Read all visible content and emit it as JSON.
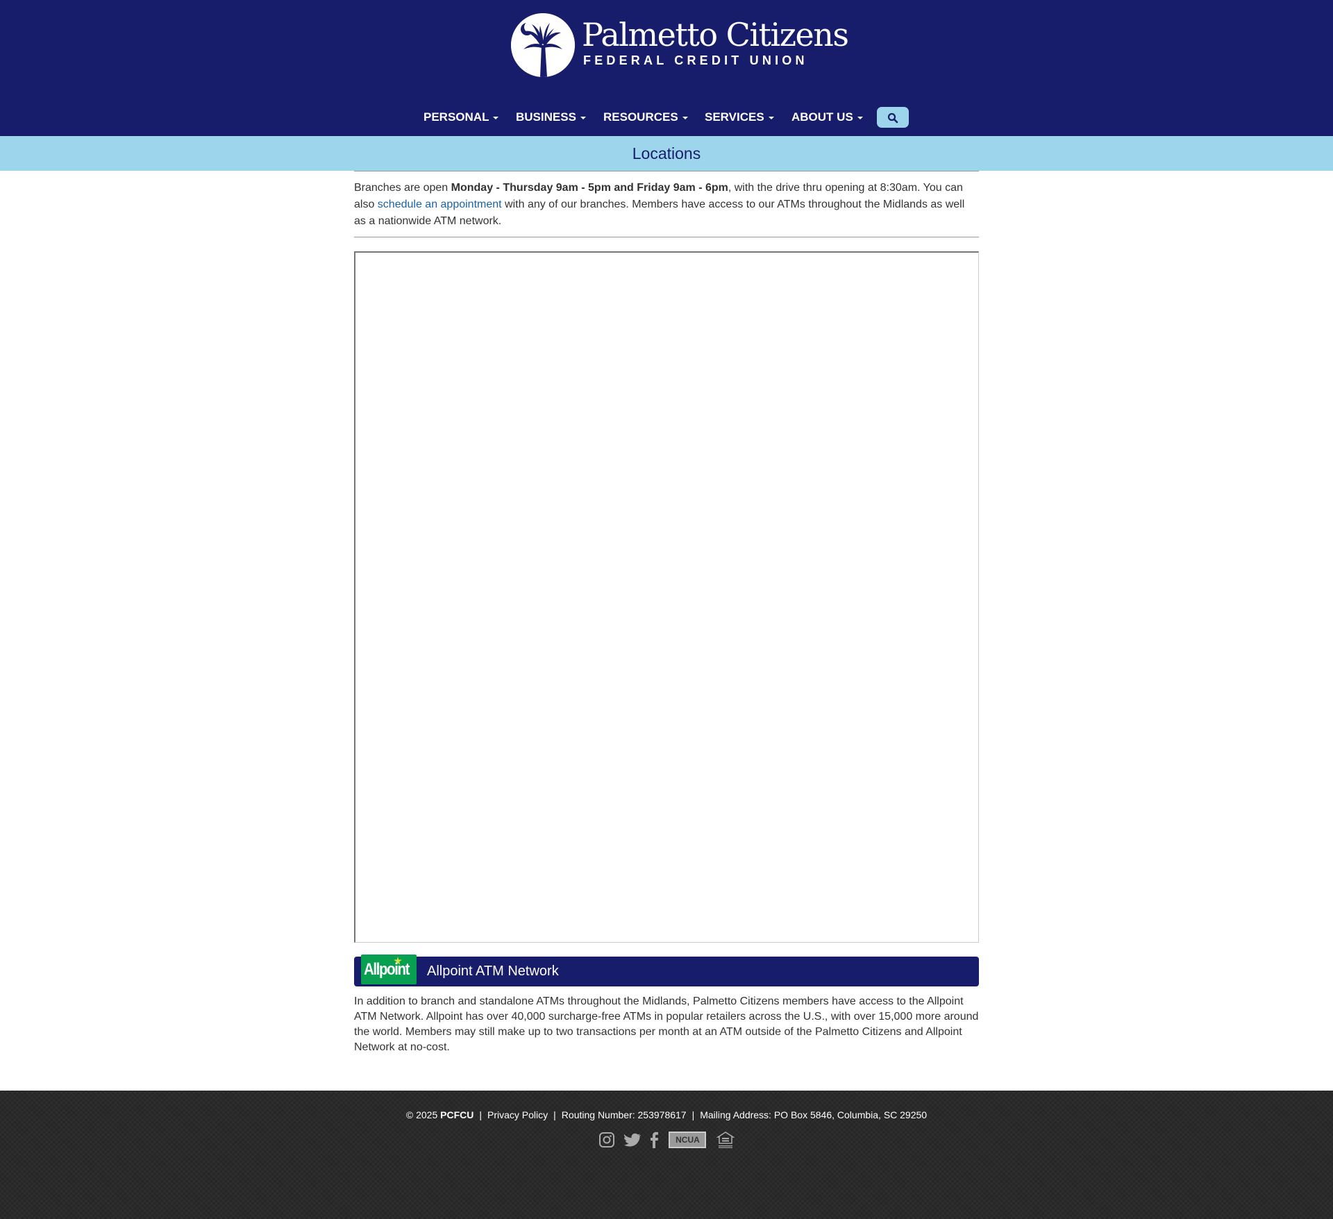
{
  "header": {
    "logo": {
      "name": "Palmetto Citizens",
      "tagline": "FEDERAL CREDIT UNION"
    },
    "nav": [
      {
        "label": "PERSONAL"
      },
      {
        "label": "BUSINESS"
      },
      {
        "label": "RESOURCES"
      },
      {
        "label": "SERVICES"
      },
      {
        "label": "ABOUT US"
      }
    ],
    "search_icon": "search-icon"
  },
  "page": {
    "title": "Locations"
  },
  "intro": {
    "part1": "Branches are open ",
    "bold": "Monday - Thursday 9am - 5pm and Friday 9am - 6pm",
    "part2": ", with the drive thru opening at 8:30am. You can also ",
    "link": "schedule an appointment",
    "part3": " with any of our branches. Members have access to our ATMs throughout the Midlands as well as a nationwide ATM network."
  },
  "allpoint": {
    "logo_text": "Allpoint",
    "title": "Allpoint ATM Network",
    "description": "In addition to branch and standalone ATMs throughout the Midlands, Palmetto Citizens members have access to the Allpoint ATM Network. Allpoint has over 40,000 surcharge-free ATMs in popular retailers across the U.S., with over 15,000 more around the world. Members may still make up to two transactions per month at an ATM outside of the Palmetto Citizens and Allpoint Network at no-cost."
  },
  "footer": {
    "copyright": "© 2025 ",
    "org": "PCFCU",
    "separator": "|",
    "privacy": "Privacy Policy",
    "routing": "Routing Number: 253978617",
    "mailing": "Mailing Address: PO Box 5846, Columbia, SC 29250",
    "icons": [
      "instagram-icon",
      "twitter-icon",
      "facebook-icon",
      "ncua-logo",
      "equal-housing-lender-icon"
    ],
    "ncua_label": "NCUA"
  },
  "colors": {
    "brand_navy": "#181d6b",
    "light_blue": "#9dd6ec",
    "link_blue": "#1a62a6",
    "allpoint_green": "#08a050",
    "footer_bg": "#2a2a2a"
  }
}
